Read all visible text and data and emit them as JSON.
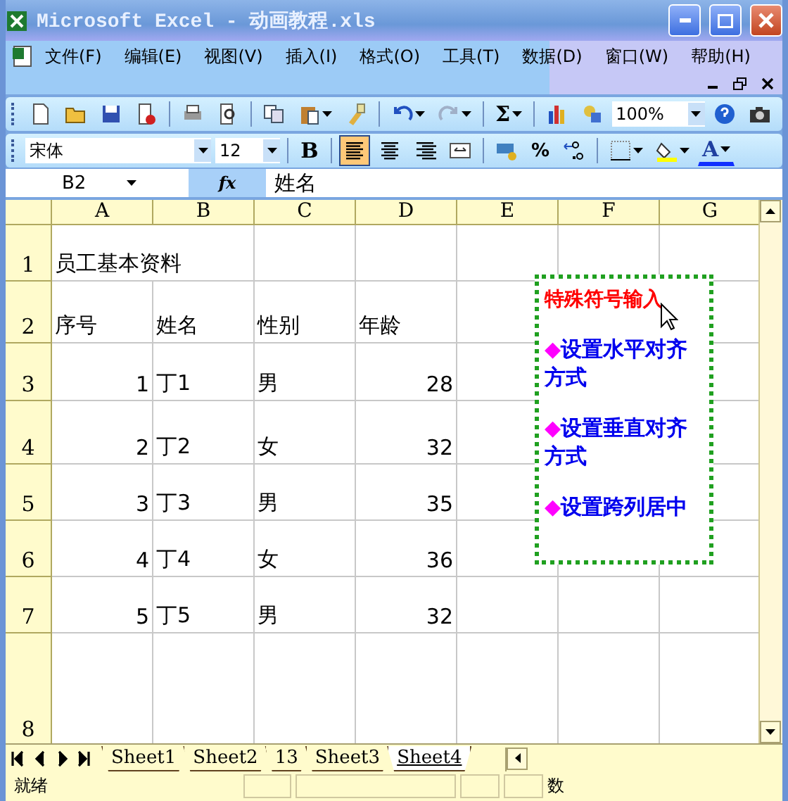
{
  "window": {
    "title": "Microsoft Excel - 动画教程.xls"
  },
  "menu": [
    {
      "label": "文件(F)"
    },
    {
      "label": "编辑(E)"
    },
    {
      "label": "视图(V)"
    },
    {
      "label": "插入(I)"
    },
    {
      "label": "格式(O)"
    },
    {
      "label": "工具(T)"
    },
    {
      "label": "数据(D)"
    },
    {
      "label": "窗口(W)"
    },
    {
      "label": "帮助(H)"
    }
  ],
  "standard_toolbar": {
    "sum_label": "Σ",
    "zoom": "100%"
  },
  "formatting_toolbar": {
    "font": "宋体",
    "size": "12",
    "bold_label": "B",
    "percent_label": "%",
    "font_color_label": "A",
    "alignment": [
      {
        "selected": true
      },
      {
        "selected": false
      },
      {
        "selected": false
      },
      {
        "selected": false
      }
    ]
  },
  "formula_bar": {
    "name_box": "B2",
    "fx_label": "fx",
    "content": "姓名"
  },
  "columns": [
    "A",
    "B",
    "C",
    "D",
    "E",
    "F",
    "G"
  ],
  "rows": [
    {
      "header": "1",
      "cells": [
        {
          "kind": "text",
          "text": "员工基本资料"
        }
      ]
    },
    {
      "header": "2",
      "cells": [
        {
          "kind": "text",
          "text": "序号"
        },
        {
          "kind": "text",
          "text": "姓名"
        },
        {
          "kind": "text",
          "text": "性别"
        },
        {
          "kind": "text",
          "text": "年龄"
        }
      ]
    },
    {
      "header": "3",
      "cells": [
        {
          "kind": "number",
          "text": "1"
        },
        {
          "kind": "text",
          "text": "丁1"
        },
        {
          "kind": "text",
          "text": "男"
        },
        {
          "kind": "number",
          "text": "28"
        }
      ]
    },
    {
      "header": "4",
      "cells": [
        {
          "kind": "number",
          "text": "2"
        },
        {
          "kind": "text",
          "text": "丁2"
        },
        {
          "kind": "text",
          "text": "女"
        },
        {
          "kind": "number",
          "text": "32"
        }
      ]
    },
    {
      "header": "5",
      "cells": [
        {
          "kind": "number",
          "text": "3"
        },
        {
          "kind": "text",
          "text": "丁3"
        },
        {
          "kind": "text",
          "text": "男"
        },
        {
          "kind": "number",
          "text": "35"
        }
      ]
    },
    {
      "header": "6",
      "cells": [
        {
          "kind": "number",
          "text": "4"
        },
        {
          "kind": "text",
          "text": "丁4"
        },
        {
          "kind": "text",
          "text": "女"
        },
        {
          "kind": "number",
          "text": "36"
        }
      ]
    },
    {
      "header": "7",
      "cells": [
        {
          "kind": "number",
          "text": "5"
        },
        {
          "kind": "text",
          "text": "丁5"
        },
        {
          "kind": "text",
          "text": "男"
        },
        {
          "kind": "number",
          "text": "32"
        }
      ]
    },
    {
      "header": "8",
      "cells": []
    }
  ],
  "text_box": {
    "title": "特殊符号输入",
    "items": [
      {
        "bullet": "◆",
        "text": "设置水平对齐方式"
      },
      {
        "bullet": "◆",
        "text": "设置垂直对齐方式"
      },
      {
        "bullet": "◆",
        "text": "设置跨列居中"
      }
    ]
  },
  "sheet_tabs": [
    {
      "label": "Sheet1",
      "selected": false
    },
    {
      "label": "Sheet2",
      "selected": false
    },
    {
      "label": "13",
      "selected": false
    },
    {
      "label": "Sheet3",
      "selected": false
    },
    {
      "label": "Sheet4",
      "selected": true
    }
  ],
  "status_bar": {
    "ready": "就绪",
    "num": "数"
  }
}
